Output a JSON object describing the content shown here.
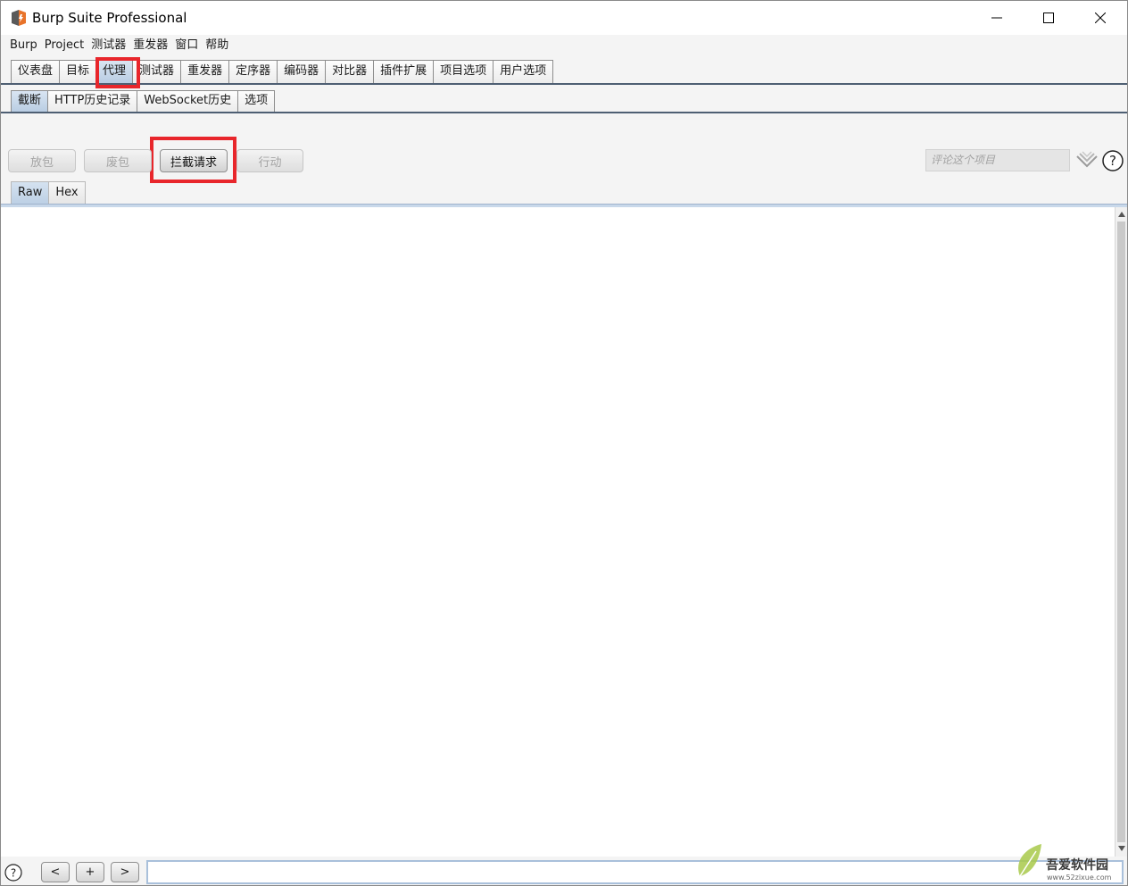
{
  "window": {
    "title": "Burp Suite Professional"
  },
  "menu": {
    "items": [
      "Burp",
      "Project",
      "测试器",
      "重发器",
      "窗口",
      "帮助"
    ]
  },
  "main_tabs": {
    "items": [
      "仪表盘",
      "目标",
      "代理",
      "测试器",
      "重发器",
      "定序器",
      "编码器",
      "对比器",
      "插件扩展",
      "项目选项",
      "用户选项"
    ],
    "active": "代理"
  },
  "sub_tabs": {
    "items": [
      "截断",
      "HTTP历史记录",
      "WebSocket历史",
      "选项"
    ],
    "active": "截断"
  },
  "toolbar": {
    "forward": "放包",
    "drop": "废包",
    "intercept": "拦截请求",
    "action": "行动",
    "comment_placeholder": "评论这个项目"
  },
  "view_tabs": {
    "items": [
      "Raw",
      "Hex"
    ],
    "active": "Raw"
  },
  "bottom": {
    "prev": "<",
    "add": "+",
    "next": ">"
  },
  "watermark": {
    "name": "吾爱软件园",
    "url": "www.52zixue.com"
  }
}
